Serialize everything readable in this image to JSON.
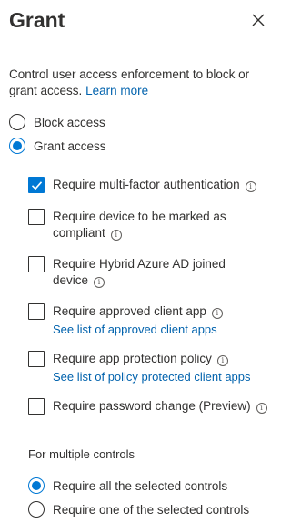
{
  "panel": {
    "title": "Grant",
    "description": "Control user access enforcement to block or grant access.",
    "learn_more": "Learn more"
  },
  "access": {
    "options": [
      {
        "label": "Block access",
        "selected": false
      },
      {
        "label": "Grant access",
        "selected": true
      }
    ]
  },
  "controls": [
    {
      "label": "Require multi-factor authentication",
      "checked": true,
      "info_icon": "info-icon"
    },
    {
      "label": "Require device to be marked as compliant",
      "checked": false,
      "info_icon": "info-icon"
    },
    {
      "label": "Require Hybrid Azure AD joined device",
      "checked": false,
      "info_icon": "info-icon"
    },
    {
      "label": "Require approved client app",
      "checked": false,
      "info_icon": "info-icon",
      "link": "See list of approved client apps"
    },
    {
      "label": "Require app protection policy",
      "checked": false,
      "info_icon": "info-icon",
      "link": "See list of policy protected client apps"
    },
    {
      "label": "Require password change (Preview)",
      "checked": false,
      "info_icon": "info-icon"
    }
  ],
  "multiple_controls": {
    "label": "For multiple controls",
    "options": [
      {
        "label": "Require all the selected controls",
        "selected": true
      },
      {
        "label": "Require one of the selected controls",
        "selected": false
      }
    ]
  },
  "colors": {
    "accent": "#0078d4",
    "link": "#0062ad",
    "text": "#323130"
  }
}
